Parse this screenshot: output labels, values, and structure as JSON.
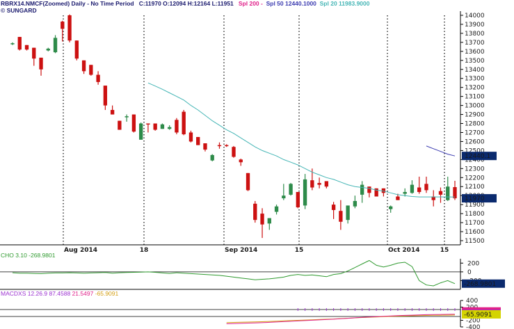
{
  "header": {
    "symbol_line": "RBRX14.NMCF(Zoomed) Daily - No Time Period",
    "ohlc": "C:11970 O:12094 H:12164 L:11951",
    "spl200": "Spl 200 -",
    "spl50": "Spl 50 12440.1000",
    "spl20": "Spl 20 11983.9000",
    "source": "© SUNGARD"
  },
  "colors": {
    "up": "#2e8b4a",
    "down": "#cc1111",
    "spl20": "#44b5b5",
    "spl50": "#3b3bb0",
    "spl200": "#e0218a",
    "cho": "#2f9a2f",
    "macd_title": "#9b30d0",
    "last_price_badge": "#0b2a6e",
    "spl50_badge": "#0b2a6e",
    "spl20_badge": "#3aa7a7"
  },
  "chart_data": [
    {
      "type": "candlestick",
      "title": "RBRX14.NMCF(Zoomed) Daily",
      "ylim": [
        11500,
        14000
      ],
      "y_ticks": [
        11500,
        11600,
        11700,
        11800,
        11900,
        12000,
        12100,
        12200,
        12300,
        12400,
        12500,
        12600,
        12700,
        12800,
        12900,
        13000,
        13100,
        13200,
        13300,
        13400,
        13500,
        13600,
        13700,
        13800,
        13900,
        14000
      ],
      "x_labels": [
        "Aug 2014",
        "18",
        "Sep 2014",
        "15",
        "Oct 2014",
        "15"
      ],
      "last_price_label": "11970",
      "spl50_label": "12440.1",
      "candles": [
        {
          "o": 13690,
          "h": 13700,
          "l": 13670,
          "c": 13690
        },
        {
          "o": 13760,
          "h": 13760,
          "l": 13610,
          "c": 13620
        },
        {
          "o": 13670,
          "h": 13670,
          "l": 13610,
          "c": 13620
        },
        {
          "o": 13640,
          "h": 13640,
          "l": 13440,
          "c": 13520
        },
        {
          "o": 13530,
          "h": 13530,
          "l": 13330,
          "c": 13400
        },
        {
          "o": 13610,
          "h": 13640,
          "l": 13600,
          "c": 13630
        },
        {
          "o": 13590,
          "h": 13780,
          "l": 13580,
          "c": 13750
        },
        {
          "o": 13930,
          "h": 13940,
          "l": 13710,
          "c": 13850
        },
        {
          "o": 14000,
          "h": 14010,
          "l": 13700,
          "c": 13720
        },
        {
          "o": 13720,
          "h": 13720,
          "l": 13500,
          "c": 13520
        },
        {
          "o": 13500,
          "h": 13500,
          "l": 13350,
          "c": 13380
        },
        {
          "o": 13450,
          "h": 13450,
          "l": 13330,
          "c": 13340
        },
        {
          "o": 13340,
          "h": 13380,
          "l": 13230,
          "c": 13260
        },
        {
          "o": 13220,
          "h": 13220,
          "l": 12950,
          "c": 13000
        },
        {
          "o": 12950,
          "h": 13000,
          "l": 12900,
          "c": 12900
        },
        {
          "o": 12830,
          "h": 12830,
          "l": 12730,
          "c": 12730
        },
        {
          "o": 12880,
          "h": 12900,
          "l": 12820,
          "c": 12880
        },
        {
          "o": 12900,
          "h": 12900,
          "l": 12700,
          "c": 12710
        },
        {
          "o": 12620,
          "h": 12810,
          "l": 12620,
          "c": 12800
        },
        {
          "o": 12800,
          "h": 12800,
          "l": 12700,
          "c": 12790
        },
        {
          "o": 12800,
          "h": 12800,
          "l": 12720,
          "c": 12730
        },
        {
          "o": 12740,
          "h": 12800,
          "l": 12740,
          "c": 12790
        },
        {
          "o": 12740,
          "h": 12780,
          "l": 12730,
          "c": 12760
        },
        {
          "o": 12840,
          "h": 12860,
          "l": 12680,
          "c": 12700
        },
        {
          "o": 12930,
          "h": 12950,
          "l": 12670,
          "c": 12680
        },
        {
          "o": 12700,
          "h": 12720,
          "l": 12590,
          "c": 12600
        },
        {
          "o": 12650,
          "h": 12650,
          "l": 12560,
          "c": 12560
        },
        {
          "o": 12580,
          "h": 12580,
          "l": 12490,
          "c": 12510
        },
        {
          "o": 12390,
          "h": 12460,
          "l": 12380,
          "c": 12450
        },
        {
          "o": 12560,
          "h": 12590,
          "l": 12520,
          "c": 12550
        },
        {
          "o": 12560,
          "h": 12570,
          "l": 12540,
          "c": 12550
        },
        {
          "o": 12540,
          "h": 12550,
          "l": 12420,
          "c": 12430
        },
        {
          "o": 12400,
          "h": 12410,
          "l": 12330,
          "c": 12370
        },
        {
          "o": 12250,
          "h": 12250,
          "l": 12050,
          "c": 12060
        },
        {
          "o": 11910,
          "h": 11940,
          "l": 11700,
          "c": 11730
        },
        {
          "o": 11800,
          "h": 11860,
          "l": 11530,
          "c": 11680
        },
        {
          "o": 11690,
          "h": 11750,
          "l": 11620,
          "c": 11750
        },
        {
          "o": 11820,
          "h": 11900,
          "l": 11790,
          "c": 11880
        },
        {
          "o": 11970,
          "h": 12130,
          "l": 11950,
          "c": 12000
        },
        {
          "o": 12010,
          "h": 12140,
          "l": 12000,
          "c": 12130
        },
        {
          "o": 12040,
          "h": 12040,
          "l": 11860,
          "c": 11870
        },
        {
          "o": 11890,
          "h": 12240,
          "l": 11850,
          "c": 12180
        },
        {
          "o": 12170,
          "h": 12300,
          "l": 12060,
          "c": 12090
        },
        {
          "o": 12140,
          "h": 12200,
          "l": 12080,
          "c": 12120
        },
        {
          "o": 12160,
          "h": 12160,
          "l": 12080,
          "c": 12100
        },
        {
          "o": 11900,
          "h": 11930,
          "l": 11740,
          "c": 11840
        },
        {
          "o": 11830,
          "h": 11950,
          "l": 11620,
          "c": 11710
        },
        {
          "o": 11730,
          "h": 11890,
          "l": 11690,
          "c": 11890
        },
        {
          "o": 11880,
          "h": 12000,
          "l": 11860,
          "c": 11940
        },
        {
          "o": 12010,
          "h": 12160,
          "l": 11920,
          "c": 12120
        },
        {
          "o": 12100,
          "h": 12100,
          "l": 11980,
          "c": 12030
        },
        {
          "o": 12080,
          "h": 12080,
          "l": 11990,
          "c": 11990
        },
        {
          "o": 12080,
          "h": 12080,
          "l": 11990,
          "c": 12030
        },
        {
          "o": 11850,
          "h": 11890,
          "l": 11810,
          "c": 11880
        },
        {
          "o": 11990,
          "h": 12020,
          "l": 11950,
          "c": 11950
        },
        {
          "o": 12020,
          "h": 12080,
          "l": 11990,
          "c": 12040
        },
        {
          "o": 12030,
          "h": 12170,
          "l": 12020,
          "c": 12120
        },
        {
          "o": 12090,
          "h": 12210,
          "l": 12020,
          "c": 12040
        },
        {
          "o": 12130,
          "h": 12210,
          "l": 12030,
          "c": 12060
        },
        {
          "o": 11990,
          "h": 12060,
          "l": 11880,
          "c": 11950
        },
        {
          "o": 12050,
          "h": 12090,
          "l": 11920,
          "c": 12010
        },
        {
          "o": 11950,
          "h": 12210,
          "l": 11940,
          "c": 12100
        },
        {
          "o": 12094,
          "h": 12164,
          "l": 11951,
          "c": 11970
        }
      ],
      "spl20": [
        null,
        null,
        null,
        null,
        null,
        null,
        null,
        null,
        null,
        null,
        null,
        null,
        null,
        null,
        null,
        null,
        null,
        null,
        null,
        13250,
        13215,
        13180,
        13140,
        13100,
        13060,
        13000,
        12950,
        12890,
        12830,
        12780,
        12730,
        12690,
        12640,
        12590,
        12540,
        12500,
        12470,
        12440,
        12400,
        12370,
        12340,
        12300,
        12260,
        12230,
        12200,
        12180,
        12150,
        12120,
        12100,
        12090,
        12080,
        12060,
        12050,
        12030,
        12010,
        12000,
        11990,
        11985,
        11985,
        11985,
        11985,
        11985,
        11984
      ],
      "spl50": [
        null,
        null,
        null,
        null,
        null,
        null,
        null,
        null,
        null,
        null,
        null,
        null,
        null,
        null,
        null,
        null,
        null,
        null,
        null,
        null,
        null,
        null,
        null,
        null,
        null,
        null,
        null,
        null,
        null,
        null,
        null,
        null,
        null,
        null,
        null,
        null,
        null,
        null,
        null,
        null,
        null,
        null,
        null,
        null,
        null,
        null,
        null,
        null,
        null,
        null,
        null,
        null,
        null,
        null,
        null,
        null,
        null,
        null,
        12550,
        12520,
        12490,
        12460,
        12440
      ]
    },
    {
      "type": "line",
      "title": "CHO 3.10 -268.9801",
      "ylim": [
        -400,
        300
      ],
      "y_ticks": [
        200,
        0,
        -200
      ],
      "last_value_label": "-268.9801",
      "values": [
        -20,
        -30,
        -30,
        -35,
        -40,
        -30,
        -25,
        -25,
        -20,
        -25,
        -30,
        -25,
        -20,
        -15,
        -30,
        -20,
        -15,
        -10,
        -5,
        0,
        -10,
        -25,
        -35,
        -20,
        -30,
        -40,
        -50,
        -60,
        -70,
        -80,
        -100,
        -120,
        -140,
        -160,
        -180,
        -170,
        -160,
        -140,
        -120,
        -80,
        -60,
        -80,
        -70,
        -90,
        -110,
        -60,
        -40,
        20,
        100,
        180,
        260,
        150,
        110,
        150,
        200,
        220,
        120,
        -200,
        -300,
        -320,
        -250,
        -200,
        -269
      ]
    },
    {
      "type": "line",
      "title": "MACDXS 12.26.9",
      "ylim": [
        -400,
        400
      ],
      "y_ticks": [
        400,
        200,
        -200,
        -400
      ],
      "macd_label": "87.4588",
      "signal_label": "21.5497",
      "hist_label": "-65.9091",
      "last_value_label": "-65.9091",
      "values": [
        null,
        null,
        null,
        null,
        null,
        null,
        null,
        null,
        null,
        null,
        null,
        null,
        null,
        null,
        null,
        null,
        null,
        null,
        null,
        null,
        null,
        null,
        null,
        null,
        null,
        null,
        null,
        null,
        null,
        null,
        -380,
        -370,
        -360,
        -350,
        -340,
        -330,
        -315,
        -300,
        -285,
        -270,
        -255,
        -240,
        -225,
        -210,
        -195,
        -180,
        -160,
        -140,
        -120,
        -100,
        -85,
        -70,
        -55,
        -40,
        -25,
        -15,
        -5,
        5,
        15,
        20,
        25,
        30,
        35
      ]
    }
  ]
}
